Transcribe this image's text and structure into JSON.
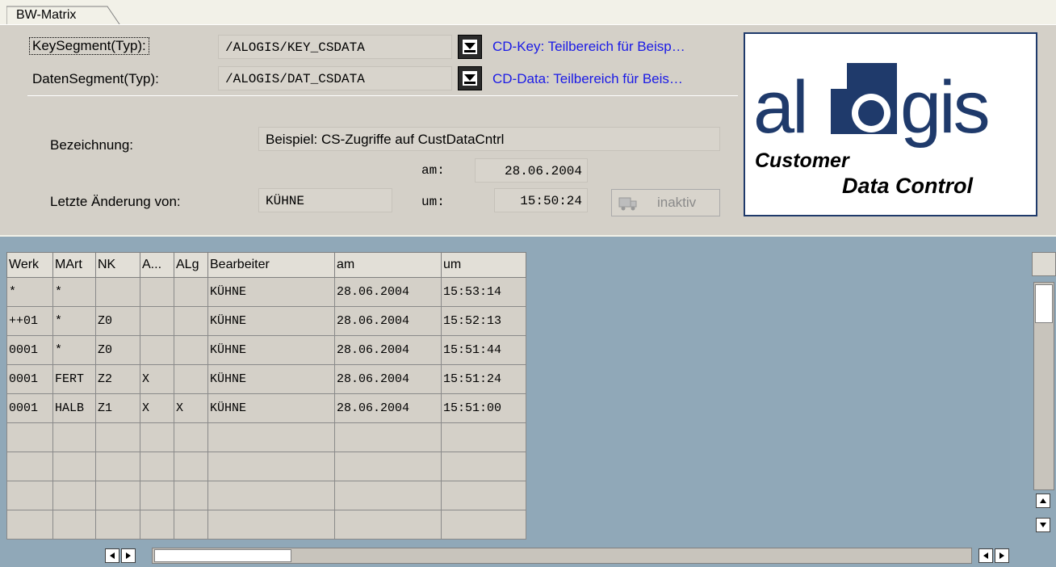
{
  "tab": {
    "label": "BW-Matrix"
  },
  "form": {
    "key_segment_label": "KeySegment(Typ):",
    "key_segment_value": "/ALOGIS/KEY_CSDATA",
    "key_segment_desc": "CD-Key: Teilbereich für Beisp…",
    "data_segment_label": "DatenSegment(Typ):",
    "data_segment_value": "/ALOGIS/DAT_CSDATA",
    "data_segment_desc": "CD-Data: Teilbereich für Beis…",
    "bezeichnung_label": "Bezeichnung:",
    "bezeichnung_value": "Beispiel: CS-Zugriffe auf CustDataCntrl",
    "am_label": "am:",
    "am_value": "28.06.2004",
    "changed_by_label": "Letzte Änderung von:",
    "changed_by_value": "KÜHNE",
    "um_label": "um:",
    "um_value": "15:50:24",
    "inactive_button": "inaktiv"
  },
  "logo": {
    "brand": "alogis",
    "line1": "Customer",
    "line2": "Data Control",
    "color": "#1f3a6b"
  },
  "table": {
    "headers": [
      "Werk",
      "MArt",
      "NK",
      "A...",
      "ALg",
      "Bearbeiter",
      "am",
      "um"
    ],
    "rows": [
      [
        "*",
        "*",
        "",
        "",
        "",
        "KÜHNE",
        "28.06.2004",
        "15:53:14"
      ],
      [
        "++01",
        "*",
        "Z0",
        "",
        "",
        "KÜHNE",
        "28.06.2004",
        "15:52:13"
      ],
      [
        "0001",
        "*",
        "Z0",
        "",
        "",
        "KÜHNE",
        "28.06.2004",
        "15:51:44"
      ],
      [
        "0001",
        "FERT",
        "Z2",
        "X",
        "",
        "KÜHNE",
        "28.06.2004",
        "15:51:24"
      ],
      [
        "0001",
        "HALB",
        "Z1",
        "X",
        "X",
        "KÜHNE",
        "28.06.2004",
        "15:51:00"
      ],
      [
        "",
        "",
        "",
        "",
        "",
        "",
        "",
        ""
      ],
      [
        "",
        "",
        "",
        "",
        "",
        "",
        "",
        ""
      ],
      [
        "",
        "",
        "",
        "",
        "",
        "",
        "",
        ""
      ],
      [
        "",
        "",
        "",
        "",
        "",
        "",
        "",
        ""
      ]
    ]
  },
  "colors": {
    "link": "#1a1ae6",
    "grid_background": "#90a8b8",
    "panel": "#d4d0c8"
  }
}
